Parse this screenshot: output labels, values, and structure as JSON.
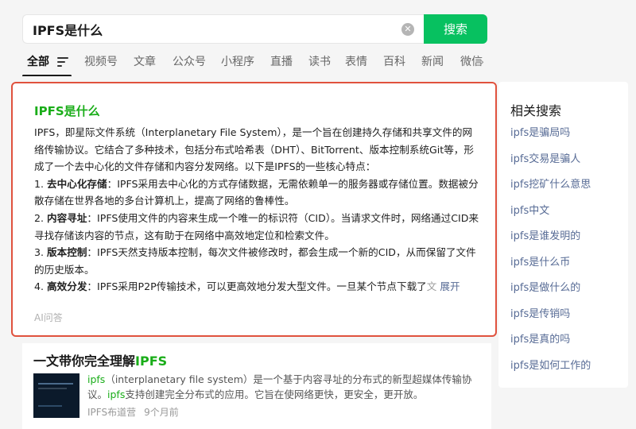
{
  "search": {
    "query": "IPFS是什么",
    "button_label": "搜索"
  },
  "tabs": [
    {
      "label": "全部"
    },
    {
      "label": "视频号"
    },
    {
      "label": "文章"
    },
    {
      "label": "公众号"
    },
    {
      "label": "小程序"
    },
    {
      "label": "直播"
    },
    {
      "label": "读书"
    },
    {
      "label": "表情"
    },
    {
      "label": "百科"
    },
    {
      "label": "新闻"
    },
    {
      "label": "微信"
    }
  ],
  "ai_answer": {
    "title": "IPFS是什么",
    "intro": "IPFS，即星际文件系统（Interplanetary File System），是一个旨在创建持久存储和共享文件的网络传输协议。它结合了多种技术，包括分布式哈希表（DHT）、BitTorrent、版本控制系统Git等，形成了一个去中心化的文件存储和内容分发网络。以下是IPFS的一些核心特点：",
    "points": [
      {
        "num": "1.",
        "term": "去中心化存储",
        "text": "：IPFS采用去中心化的方式存储数据，无需依赖单一的服务器或存储位置。数据被分散存储在世界各地的多台计算机上，提高了网络的鲁棒性。"
      },
      {
        "num": "2.",
        "term": "内容寻址",
        "text": "：IPFS使用文件的内容来生成一个唯一的标识符（CID）。当请求文件时，网络通过CID来寻找存储该内容的节点，这有助于在网络中高效地定位和检索文件。"
      },
      {
        "num": "3.",
        "term": "版本控制",
        "text": "：IPFS天然支持版本控制，每次文件被修改时，都会生成一个新的CID，从而保留了文件的历史版本。"
      },
      {
        "num": "4.",
        "term": "高效分发",
        "text": "：IPFS采用P2P传输技术，可以更高效地分发大型文件。一旦某个节点下载了",
        "fade_text": "文"
      }
    ],
    "expand_label": "展开",
    "source_label": "AI问答"
  },
  "article": {
    "title_prefix": "一文带你完全理解",
    "title_highlight": "IPFS",
    "snippet_highlight1": "ipfs",
    "snippet_part1": "（interplanetary file system）是一个基于内容寻址的分布式的新型超媒体传输协议。",
    "snippet_highlight2": "ipfs",
    "snippet_part2": "支持创建完全分布式的应用。它旨在使网络更快，更安全，更开放。",
    "source": "IPFS布道营",
    "time": "9个月前"
  },
  "related": {
    "title": "相关搜索",
    "items": [
      "ipfs是骗局吗",
      "ipfs交易是骗人",
      "ipfs挖矿什么意思",
      "ipfs中文",
      "ipfs是谁发明的",
      "ipfs是什么币",
      "ipfs是做什么的",
      "ipfs是传销吗",
      "ipfs是真的吗",
      "ipfs是如何工作的"
    ]
  },
  "colors": {
    "brand_green": "#07c160",
    "highlight_green": "#1aad19",
    "link_blue": "#576b95",
    "card_border_red": "#e0523e"
  }
}
